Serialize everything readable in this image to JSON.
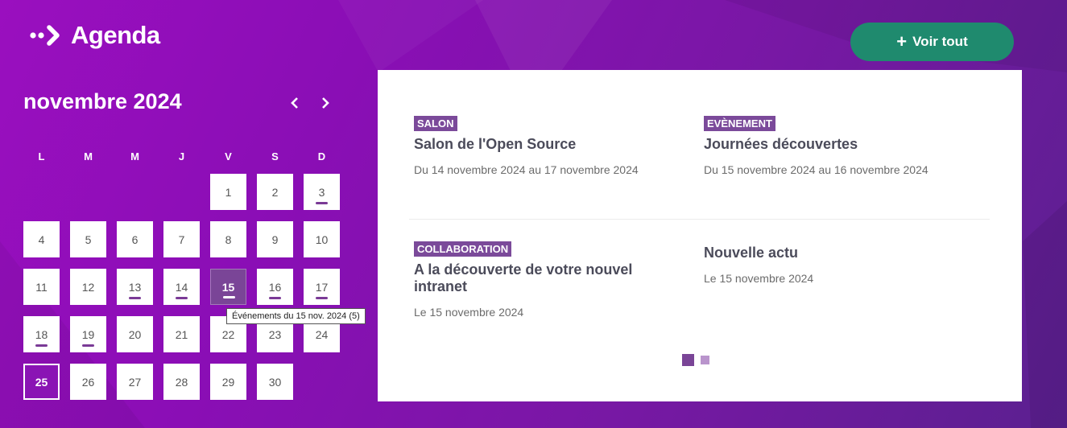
{
  "header": {
    "title": "Agenda",
    "logo_icon": "arrow-dots-icon"
  },
  "toolbar": {
    "voir_tout_label": "Voir tout",
    "plus_symbol": "+"
  },
  "calendar": {
    "month_label": "novembre 2024",
    "prev_symbol": "‹",
    "next_symbol": "›",
    "weekdays": [
      "L",
      "M",
      "M",
      "J",
      "V",
      "S",
      "D"
    ],
    "selected_day": 15,
    "today": 25,
    "days": [
      {
        "n": "1",
        "dot": false
      },
      {
        "n": "2",
        "dot": false
      },
      {
        "n": "3",
        "dot": true
      },
      {
        "n": "4",
        "dot": false
      },
      {
        "n": "5",
        "dot": false
      },
      {
        "n": "6",
        "dot": false
      },
      {
        "n": "7",
        "dot": false
      },
      {
        "n": "8",
        "dot": false
      },
      {
        "n": "9",
        "dot": false
      },
      {
        "n": "10",
        "dot": false
      },
      {
        "n": "11",
        "dot": false
      },
      {
        "n": "12",
        "dot": false
      },
      {
        "n": "13",
        "dot": true
      },
      {
        "n": "14",
        "dot": true
      },
      {
        "n": "15",
        "dot": true
      },
      {
        "n": "16",
        "dot": true
      },
      {
        "n": "17",
        "dot": true
      },
      {
        "n": "18",
        "dot": true
      },
      {
        "n": "19",
        "dot": true
      },
      {
        "n": "20",
        "dot": false
      },
      {
        "n": "21",
        "dot": false
      },
      {
        "n": "22",
        "dot": false
      },
      {
        "n": "23",
        "dot": false
      },
      {
        "n": "24",
        "dot": false
      },
      {
        "n": "25",
        "dot": false
      },
      {
        "n": "26",
        "dot": false
      },
      {
        "n": "27",
        "dot": false
      },
      {
        "n": "28",
        "dot": false
      },
      {
        "n": "29",
        "dot": false
      },
      {
        "n": "30",
        "dot": false
      }
    ],
    "tooltip": "Événements du 15 nov. 2024 (5)"
  },
  "events": [
    {
      "tag": "SALON",
      "title": "Salon de l'Open Source",
      "date": "Du 14 novembre 2024 au 17 novembre 2024"
    },
    {
      "tag": "EVÈNEMENT",
      "title": "Journées découvertes",
      "date": "Du 15 novembre 2024 au 16 novembre 2024"
    },
    {
      "tag": "COLLABORATION",
      "title": "A la découverte de votre nouvel intranet",
      "date": "Le 15 novembre 2024"
    },
    {
      "tag": "",
      "title": "Nouvelle actu",
      "date": "Le 15 novembre 2024"
    }
  ],
  "pager": {
    "pages": 2,
    "active": 1
  },
  "colors": {
    "accent": "#7a4597",
    "button": "#1f8a6e",
    "background": "#8a0eb5"
  }
}
